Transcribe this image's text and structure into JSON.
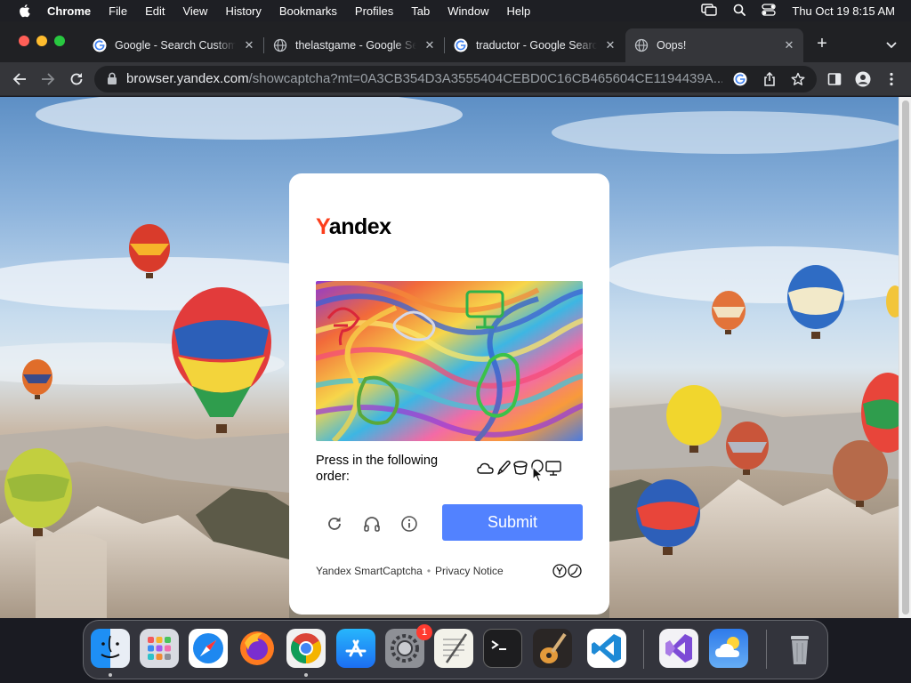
{
  "menubar": {
    "app": "Chrome",
    "items": [
      "File",
      "Edit",
      "View",
      "History",
      "Bookmarks",
      "Profiles",
      "Tab",
      "Window",
      "Help"
    ],
    "clock": "Thu Oct 19  8:15 AM"
  },
  "tabs": [
    {
      "title": "Google - Search Custom",
      "icon": "google-icon",
      "active": false
    },
    {
      "title": "thelastgame - Google Search",
      "icon": "globe-icon",
      "active": false
    },
    {
      "title": "traductor - Google Search",
      "icon": "google-icon",
      "active": false
    },
    {
      "title": "Oops!",
      "icon": "globe-icon",
      "active": true
    }
  ],
  "toolbar": {
    "url_host": "browser.yandex.com",
    "url_path": "/showcaptcha?mt=0A3CB354D3A3555404CEBD0C16CB465604CE1194439A..."
  },
  "captcha": {
    "logo_first": "Y",
    "logo_rest": "andex",
    "instruction": "Press in the following order:",
    "hint_icons": [
      "cloud-icon",
      "pencil-icon",
      "bucket-icon",
      "balloon-icon",
      "monitor-icon"
    ],
    "submit_label": "Submit",
    "footer_brand": "Yandex SmartCaptcha",
    "footer_separator": "•",
    "footer_privacy": "Privacy Notice"
  },
  "colors": {
    "accent": "#5282ff",
    "yandex_red": "#fc3f1d"
  },
  "dock": {
    "notification_badge": "1",
    "apps": [
      "finder-icon",
      "launchpad-icon",
      "safari-icon",
      "firefox-icon",
      "chrome-icon",
      "app-store-icon",
      "system-settings-icon",
      "textedit-icon",
      "terminal-icon",
      "garageband-icon",
      "vscode-icon",
      "visual-studio-icon",
      "weather-icon",
      "trash-icon"
    ]
  }
}
